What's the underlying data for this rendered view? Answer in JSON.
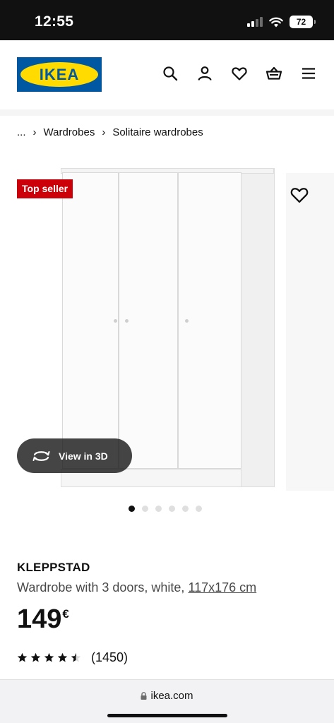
{
  "status_bar": {
    "time": "12:55",
    "battery": "72",
    "icons": [
      "signal-icon",
      "wifi-icon",
      "battery-icon"
    ]
  },
  "header": {
    "logo_text": "IKEA",
    "icons": [
      "search-icon",
      "account-icon",
      "heart-icon",
      "basket-icon",
      "menu-icon"
    ],
    "colors": {
      "logo_blue": "#0058a3",
      "logo_yellow": "#ffdb00"
    }
  },
  "breadcrumb": {
    "ellipsis": "...",
    "items": [
      "Wardrobes",
      "Solitaire wardrobes"
    ]
  },
  "gallery": {
    "badge": "Top seller",
    "badge_color": "#cc0008",
    "view_3d_label": "View in 3D",
    "image_count": 6,
    "active_image": 1
  },
  "product": {
    "name": "KLEPPSTAD",
    "description": "Wardrobe with 3 doors, white,",
    "measurement": "117x176 cm",
    "price": "149",
    "currency": "€",
    "rating": 4.5,
    "rating_max": 5,
    "reviews": "(1450)"
  },
  "browser": {
    "url": "ikea.com"
  }
}
